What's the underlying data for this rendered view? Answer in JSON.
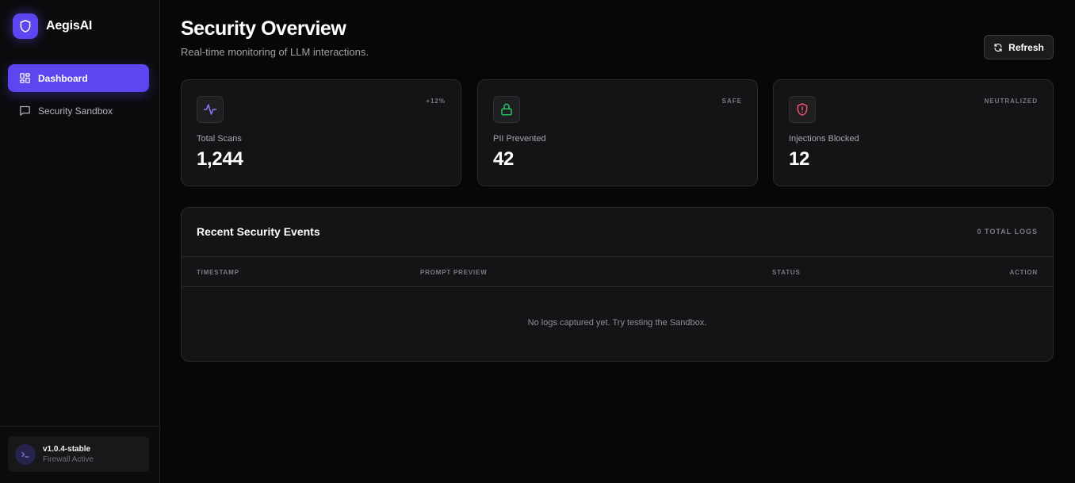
{
  "brand": {
    "name": "AegisAI",
    "logo_icon": "shield-icon"
  },
  "sidebar": {
    "items": [
      {
        "label": "Dashboard",
        "icon": "dashboard-grid-icon",
        "active": true
      },
      {
        "label": "Security Sandbox",
        "icon": "chat-bubble-icon",
        "active": false
      }
    ],
    "footer": {
      "version": "v1.0.4-stable",
      "status": "Firewall Active",
      "icon": "terminal-icon"
    }
  },
  "header": {
    "title": "Security Overview",
    "subtitle": "Real-time monitoring of LLM interactions.",
    "refresh_label": "Refresh",
    "refresh_icon": "refresh-icon"
  },
  "stats": [
    {
      "label": "Total Scans",
      "value": "1,244",
      "badge": "+12%",
      "icon": "activity-icon",
      "color": "#8b7cf6"
    },
    {
      "label": "PII Prevented",
      "value": "42",
      "badge": "SAFE",
      "icon": "lock-icon",
      "color": "#22c55e"
    },
    {
      "label": "Injections Blocked",
      "value": "12",
      "badge": "NEUTRALIZED",
      "icon": "shield-alert-icon",
      "color": "#f0506e"
    }
  ],
  "events": {
    "title": "Recent Security Events",
    "count_label": "0 TOTAL LOGS",
    "columns": [
      "TIMESTAMP",
      "PROMPT PREVIEW",
      "STATUS",
      "ACTION"
    ],
    "empty_message": "No logs captured yet. Try testing the Sandbox."
  },
  "colors": {
    "accent": "#5b46f0",
    "background": "#070708",
    "card": "#141416"
  }
}
